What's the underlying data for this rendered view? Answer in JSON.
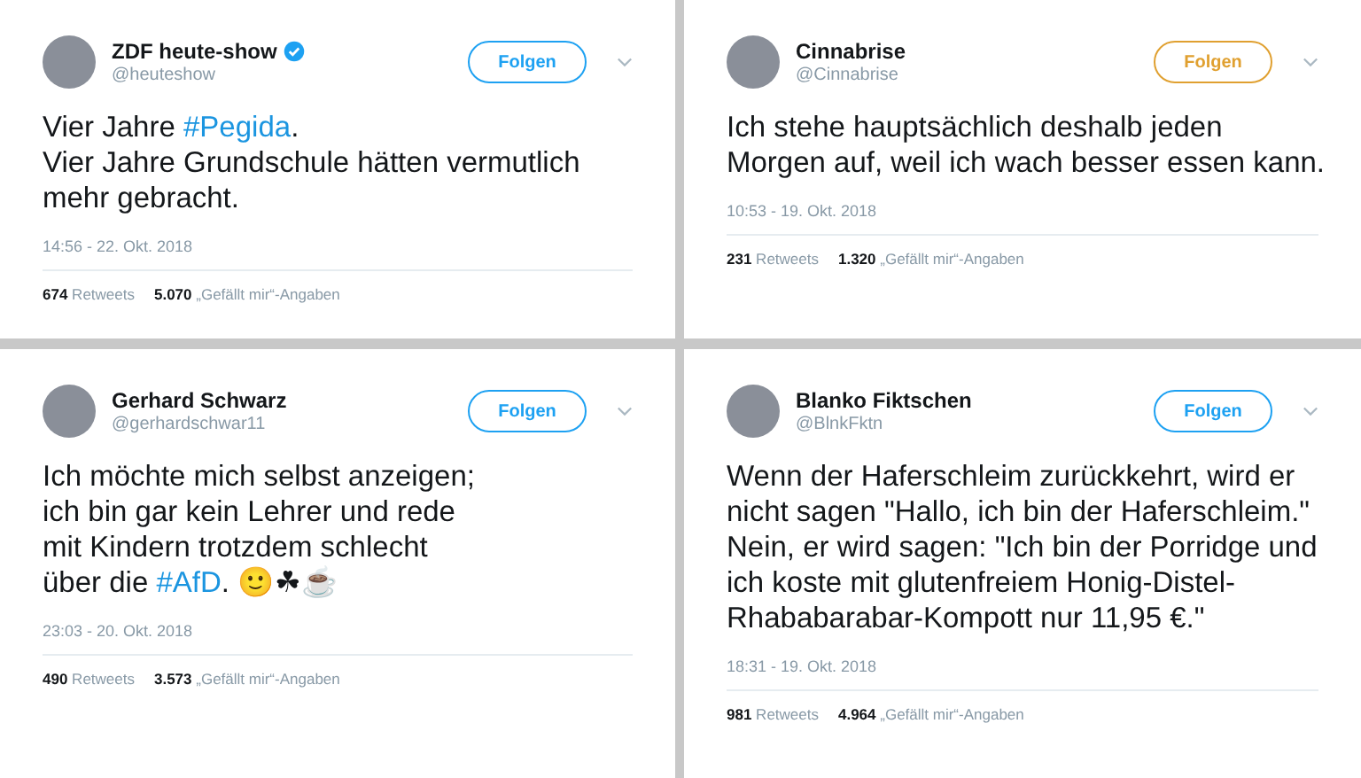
{
  "tweets": [
    {
      "name": "ZDF heute-show",
      "verified": true,
      "handle": "@heuteshow",
      "follow": "Folgen",
      "color": "#1da1f2",
      "lines": [
        [
          {
            "kind": "text",
            "text": "Vier Jahre "
          },
          {
            "kind": "hashtag",
            "text": "#Pegida"
          },
          {
            "kind": "text",
            "text": "."
          }
        ],
        [
          {
            "kind": "text",
            "text": "Vier Jahre Grundschule hätten vermutlich"
          }
        ],
        [
          {
            "kind": "text",
            "text": "mehr gebracht."
          }
        ]
      ],
      "time": "14:56 - 22. Okt. 2018",
      "stats": [
        "**674** Retweets",
        "**5.070** „Gefällt mir“-Angaben"
      ]
    },
    {
      "name": "Cinnabrise",
      "verified": false,
      "handle": "@Cinnabrise",
      "follow": "Folgen",
      "color": "#e0a030",
      "lines": [
        [
          {
            "kind": "text",
            "text": "Ich stehe hauptsächlich deshalb jeden"
          }
        ],
        [
          {
            "kind": "text",
            "text": "Morgen auf, weil ich wach besser essen kann."
          }
        ]
      ],
      "time": "10:53 - 19. Okt. 2018",
      "stats": [
        "**231** Retweets",
        "**1.320** „Gefällt mir“-Angaben"
      ]
    },
    {
      "name": "Gerhard Schwarz",
      "verified": false,
      "handle": "@gerhardschwar11",
      "follow": "Folgen",
      "color": "#1da1f2",
      "lines": [
        [
          {
            "kind": "text",
            "text": "Ich möchte mich selbst anzeigen;"
          }
        ],
        [
          {
            "kind": "text",
            "text": "ich bin gar kein Lehrer und rede"
          }
        ],
        [
          {
            "kind": "text",
            "text": "mit Kindern trotzdem schlecht"
          }
        ],
        [
          {
            "kind": "text",
            "text": "über die "
          },
          {
            "kind": "hashtag",
            "text": "#AfD"
          },
          {
            "kind": "text",
            "text": ". 🙂☘☕"
          }
        ]
      ],
      "time": "23:03 - 20. Okt. 2018",
      "stats": [
        "**490** Retweets",
        "**3.573** „Gefällt mir“-Angaben"
      ]
    },
    {
      "name": "Blanko Fiktschen",
      "verified": false,
      "handle": "@BlnkFktn",
      "follow": "Folgen",
      "color": "#1da1f2",
      "lines": [
        [
          {
            "kind": "text",
            "text": "Wenn der Haferschleim zurückkehrt, wird er"
          }
        ],
        [
          {
            "kind": "text",
            "text": "nicht sagen \"Hallo, ich bin der Haferschleim.\""
          }
        ],
        [
          {
            "kind": "text",
            "text": "Nein, er wird sagen: \"Ich bin der Porridge und"
          }
        ],
        [
          {
            "kind": "text",
            "text": "ich koste mit glutenfreiem Honig-Distel-"
          }
        ],
        [
          {
            "kind": "text",
            "text": "Rhababarabar-Kompott nur 11,95 €.\""
          }
        ]
      ],
      "time": "18:31 - 19. Okt. 2018",
      "stats": [
        "**981** Retweets",
        "**4.964** „Gefällt mir“-Angaben"
      ]
    }
  ]
}
